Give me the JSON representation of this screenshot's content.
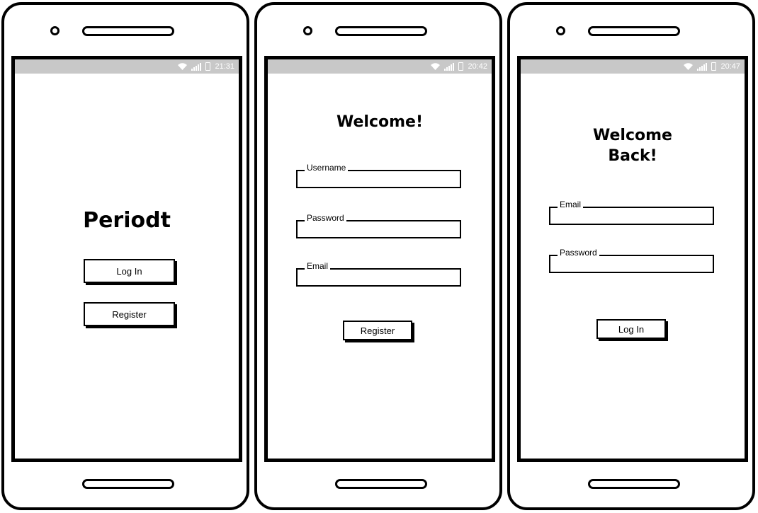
{
  "screens": [
    {
      "status_time": "21:31",
      "title": "Periodt",
      "buttons": {
        "login_label": "Log In",
        "register_label": "Register"
      }
    },
    {
      "status_time": "20:42",
      "title": "Welcome!",
      "fields": {
        "username_label": "Username",
        "password_label": "Password",
        "email_label": "Email"
      },
      "buttons": {
        "register_label": "Register"
      }
    },
    {
      "status_time": "20:47",
      "title_line1": "Welcome",
      "title_line2": "Back!",
      "fields": {
        "email_label": "Email",
        "password_label": "Password"
      },
      "buttons": {
        "login_label": "Log In"
      }
    }
  ],
  "icons": {
    "wifi": "wifi-icon",
    "signal": "signal-icon",
    "battery": "battery-icon"
  },
  "colors": {
    "status_bar": "#c8c8c8",
    "outline": "#000000",
    "background": "#ffffff"
  }
}
